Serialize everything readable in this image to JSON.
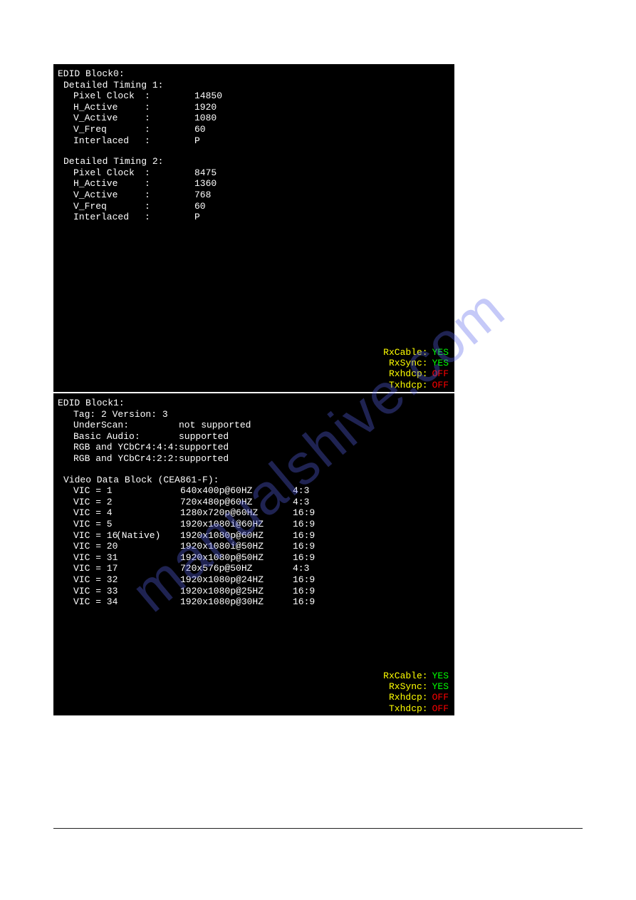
{
  "watermark": "manualshive.com",
  "block0": {
    "header": "EDID Block0:",
    "timings": [
      {
        "title": "Detailed Timing 1:",
        "rows": [
          {
            "key": "Pixel Clock",
            "colon": ":",
            "val": "14850"
          },
          {
            "key": "H_Active",
            "colon": ":",
            "val": "1920"
          },
          {
            "key": "V_Active",
            "colon": ":",
            "val": "1080"
          },
          {
            "key": "V_Freq",
            "colon": ":",
            "val": "60"
          },
          {
            "key": "Interlaced",
            "colon": ":",
            "val": "P"
          }
        ]
      },
      {
        "title": "Detailed Timing 2:",
        "rows": [
          {
            "key": "Pixel Clock",
            "colon": ":",
            "val": "8475"
          },
          {
            "key": "H_Active",
            "colon": ":",
            "val": "1360"
          },
          {
            "key": "V_Active",
            "colon": ":",
            "val": "768"
          },
          {
            "key": "V_Freq",
            "colon": ":",
            "val": "60"
          },
          {
            "key": "Interlaced",
            "colon": ":",
            "val": "P"
          }
        ]
      }
    ],
    "status": [
      {
        "label": "RxCable:",
        "value": "YES",
        "cls": "yes"
      },
      {
        "label": "RxSync:",
        "value": "YES",
        "cls": "yes"
      },
      {
        "label": "Rxhdcp:",
        "value": "OFF",
        "cls": "off"
      },
      {
        "label": "Txhdcp:",
        "value": "OFF",
        "cls": "off"
      }
    ]
  },
  "block1": {
    "header": "EDID Block1:",
    "tagline": "Tag: 2 Version: 3",
    "supportRows": [
      {
        "key": "UnderScan:",
        "val": "not supported"
      },
      {
        "key": "Basic Audio:",
        "val": "supported"
      },
      {
        "key": "RGB and YCbCr4:4:4:",
        "val": "supported"
      },
      {
        "key": "RGB and YCbCr4:2:2:",
        "val": "supported"
      }
    ],
    "vdb_header": "Video Data Block (CEA861-F):",
    "vics": [
      {
        "vic": "VIC = 1",
        "native": "",
        "res": "640x400p@60HZ",
        "aspect": "4:3"
      },
      {
        "vic": "VIC = 2",
        "native": "",
        "res": "720x480p@60HZ",
        "aspect": "4:3"
      },
      {
        "vic": "VIC = 4",
        "native": "",
        "res": "1280x720p@60HZ",
        "aspect": "16:9"
      },
      {
        "vic": "VIC = 5",
        "native": "",
        "res": "1920x1080i@60HZ",
        "aspect": "16:9"
      },
      {
        "vic": "VIC = 16",
        "native": "(Native)",
        "res": "1920x1080p@60HZ",
        "aspect": "16:9"
      },
      {
        "vic": "VIC = 20",
        "native": "",
        "res": "1920x1080i@50HZ",
        "aspect": "16:9"
      },
      {
        "vic": "VIC = 31",
        "native": "",
        "res": "1920x1080p@50HZ",
        "aspect": "16:9"
      },
      {
        "vic": "VIC = 17",
        "native": "",
        "res": "720x576p@50HZ",
        "aspect": "4:3"
      },
      {
        "vic": "VIC = 32",
        "native": "",
        "res": "1920x1080p@24HZ",
        "aspect": "16:9"
      },
      {
        "vic": "VIC = 33",
        "native": "",
        "res": "1920x1080p@25HZ",
        "aspect": "16:9"
      },
      {
        "vic": "VIC = 34",
        "native": "",
        "res": "1920x1080p@30HZ",
        "aspect": "16:9"
      }
    ],
    "status": [
      {
        "label": "RxCable:",
        "value": "YES",
        "cls": "yes"
      },
      {
        "label": "RxSync:",
        "value": "YES",
        "cls": "yes"
      },
      {
        "label": "Rxhdcp:",
        "value": "OFF",
        "cls": "off"
      },
      {
        "label": "Txhdcp:",
        "value": "OFF",
        "cls": "off"
      }
    ]
  }
}
